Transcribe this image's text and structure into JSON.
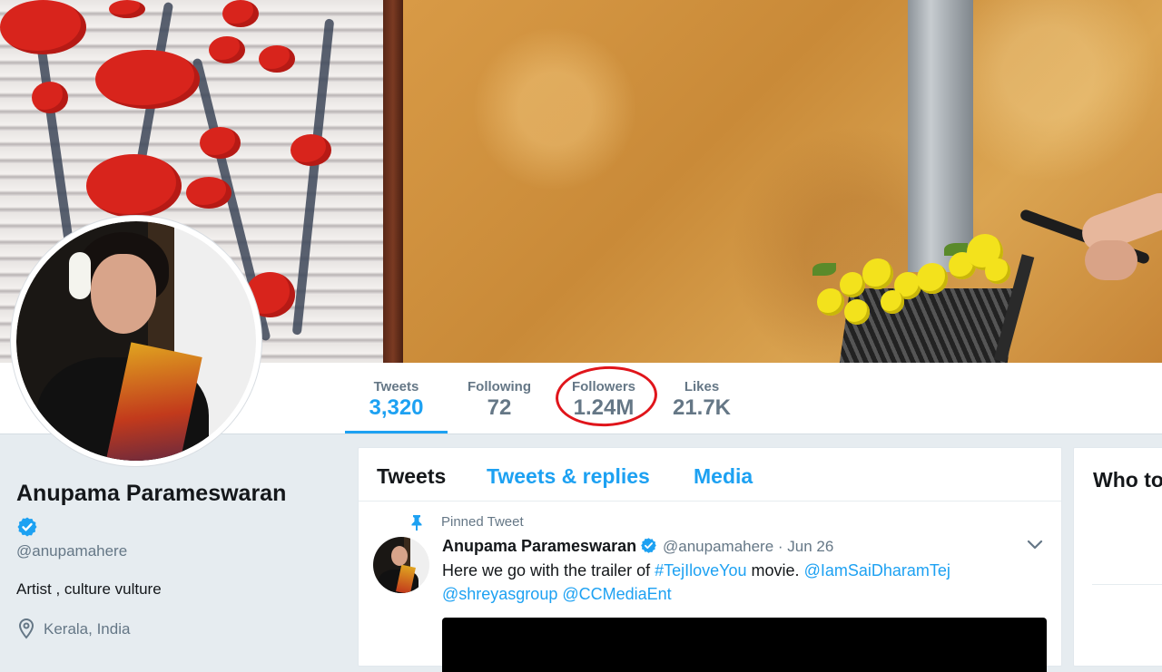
{
  "colors": {
    "accent": "#1da1f2",
    "annotation": "#e0151b",
    "text": "#14171a",
    "muted": "#657786"
  },
  "stats": [
    {
      "label": "Tweets",
      "value": "3,320"
    },
    {
      "label": "Following",
      "value": "72"
    },
    {
      "label": "Followers",
      "value": "1.24M"
    },
    {
      "label": "Likes",
      "value": "21.7K"
    }
  ],
  "profile": {
    "name": "Anupama Parameswaran",
    "handle": "@anupamahere",
    "bio": "Artist , culture vulture",
    "location": "Kerala, India",
    "verified_icon": "verified-badge-icon",
    "location_icon": "map-pin-icon"
  },
  "timeline": {
    "tabs": [
      "Tweets",
      "Tweets & replies",
      "Media"
    ],
    "pinned": {
      "label": "Pinned Tweet",
      "author_name": "Anupama Parameswaran",
      "meta": "@anupamahere · Jun 26",
      "text_prefix": "Here we go with the trailer of ",
      "hashtag": "#TejIloveYou",
      "text_mid": " movie. ",
      "mention1": "@IamSaiDharamTej",
      "mention2": "@shreyasgroup",
      "mention3": "@CCMediaEnt"
    }
  },
  "right": {
    "title": "Who to follow"
  }
}
